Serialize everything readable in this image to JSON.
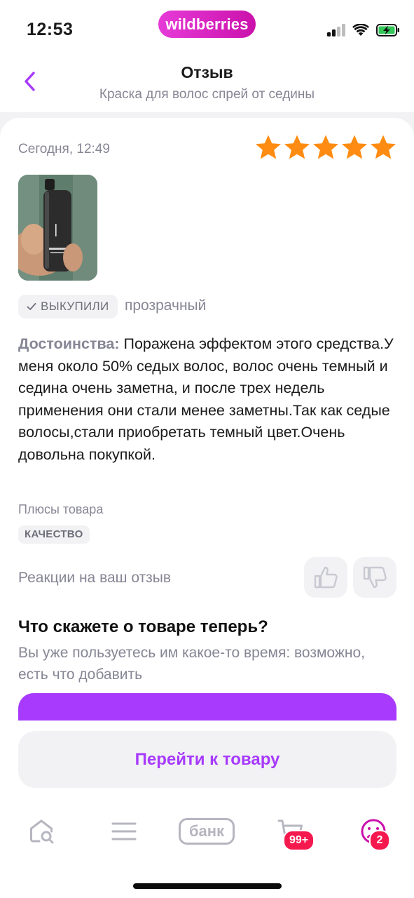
{
  "status_bar": {
    "time": "12:53",
    "brand": "wildberries"
  },
  "header": {
    "title": "Отзыв",
    "subtitle": "Краска для волос спрей от седины"
  },
  "review": {
    "date": "Сегодня, 12:49",
    "rating": 5,
    "rating_max": 5,
    "bought_badge": "ВЫКУПИЛИ",
    "variant": "прозрачный",
    "text_label": "Достоинства:",
    "text": " Поражена эффектом этого средства.У меня около 50% седых волос, волос очень темный и седина очень заметна, и после трех недель применения они стали менее заметны.Так как седые волосы,стали приобретать темный цвет.Очень довольна покупкой.",
    "pros_title": "Плюсы товара",
    "pros_tags": [
      "КАЧЕСТВО"
    ],
    "reactions_label": "Реакции на ваш отзыв"
  },
  "cta": {
    "title": "Что скажете о товаре теперь?",
    "subtitle": "Вы уже пользуетесь им какое-то время: возможно, есть что добавить"
  },
  "bottom": {
    "goto_button": "Перейти к товару"
  },
  "nav": {
    "bank_label": "банк",
    "cart_badge": "99+",
    "profile_badge": "2"
  },
  "colors": {
    "accent": "#a73afd",
    "brand": "#cb11ab",
    "star": "#ff8c12",
    "badge": "#f5194e"
  }
}
